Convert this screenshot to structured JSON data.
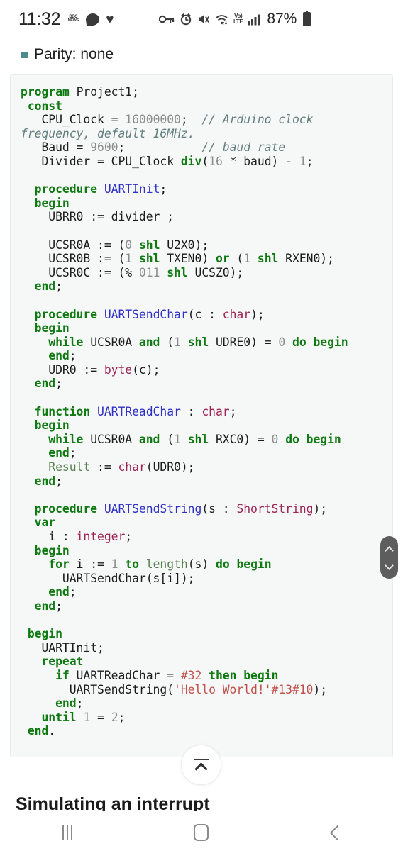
{
  "statusbar": {
    "time": "11:32",
    "news_icon_line1": "BBC",
    "news_icon_line2": "NEWS",
    "messages_icon": "chat-bubble-icon",
    "heart_glyph": "♥",
    "key_icon": "key-icon",
    "alarm_icon": "alarm-icon",
    "mute_icon": "mute-icon",
    "wifi_icon": "wifi-icon",
    "volte_line1": "Vo)",
    "volte_line2": "LTE",
    "signal_icon": "signal-bars-icon",
    "battery_percent": "87%",
    "battery_icon": "battery-icon"
  },
  "parity": {
    "bullet": "bullet-square",
    "text": "Parity: none",
    "bullet_color": "#4b8b8b"
  },
  "code": {
    "language": "pascal",
    "lines": [
      "program Project1;",
      " const",
      "   CPU_Clock = 16000000;  // Arduino clock frequency, default 16MHz.",
      "   Baud = 9600;            // baud rate",
      "   Divider = CPU_Clock div(16 * baud) - 1;",
      "",
      "  procedure UARTInit;",
      "  begin",
      "    UBRR0 := divider ;",
      "",
      "    UCSR0A := (0 shl U2X0);",
      "    UCSR0B := (1 shl TXEN0) or (1 shl RXEN0);",
      "    UCSR0C := (% 011 shl UCSZ0);",
      "  end;",
      "",
      "  procedure UARTSendChar(c : char);",
      "  begin",
      "    while UCSR0A and (1 shl UDRE0) = 0 do begin",
      "    end;",
      "    UDR0 := byte(c);",
      "  end;",
      "",
      "  function UARTReadChar : char;",
      "  begin",
      "    while UCSR0A and (1 shl RXC0) = 0 do begin",
      "    end;",
      "    Result := char(UDR0);",
      "  end;",
      "",
      "  procedure UARTSendString(s : ShortString);",
      "  var",
      "    i : integer;",
      "  begin",
      "    for i := 1 to length(s) do begin",
      "      UARTSendChar(s[i]);",
      "    end;",
      "  end;",
      "",
      " begin",
      "   UARTInit;",
      "   repeat",
      "     if UARTReadChar = #32 then begin",
      "       UARTSendString('Hello World!'#13#10);",
      "     end;",
      "   until 1 = 2;",
      " end."
    ],
    "colors": {
      "keyword": "#0e7a11",
      "identifier": "#2f31c6",
      "type": "#9c2352",
      "number": "#8c8c8c",
      "comment": "#63807f",
      "string": "#c0504a",
      "builtin": "#57804f",
      "background": "#f6f7f7"
    }
  },
  "scroll_pill": {
    "up_icon": "chevron-up-icon",
    "down_icon": "chevron-down-icon"
  },
  "fab": {
    "icon": "scroll-to-top-icon"
  },
  "next_section": {
    "heading": "Simulating an interrupt"
  },
  "navbar": {
    "recents_label": "recents-icon",
    "home_label": "home-icon",
    "back_label": "back-icon"
  }
}
